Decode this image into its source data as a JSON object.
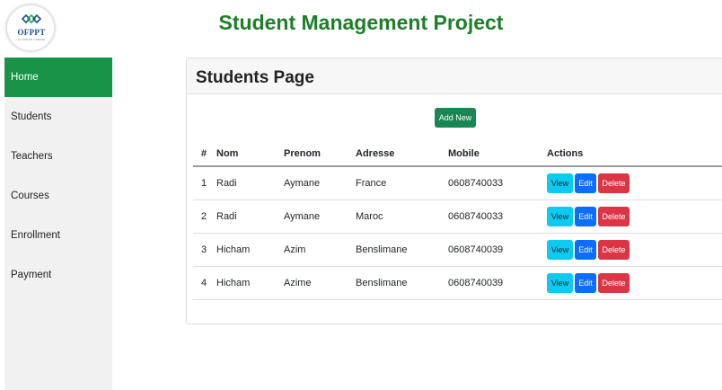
{
  "header": {
    "logo_text": "OFPPT",
    "logo_subtext": "LA VOIE DE L'AVENIR",
    "title": "Student Management Project"
  },
  "sidebar": {
    "items": [
      {
        "label": "Home",
        "active": true
      },
      {
        "label": "Students",
        "active": false
      },
      {
        "label": "Teachers",
        "active": false
      },
      {
        "label": "Courses",
        "active": false
      },
      {
        "label": "Enrollment",
        "active": false
      },
      {
        "label": "Payment",
        "active": false
      }
    ]
  },
  "page": {
    "title": "Students Page",
    "add_new_label": "Add New"
  },
  "table": {
    "columns": [
      "#",
      "Nom",
      "Prenom",
      "Adresse",
      "Mobile",
      "Actions"
    ],
    "rows": [
      {
        "id": "1",
        "nom": "Radi",
        "prenom": "Aymane",
        "adresse": "France",
        "mobile": "0608740033"
      },
      {
        "id": "2",
        "nom": "Radi",
        "prenom": "Aymane",
        "adresse": "Maroc",
        "mobile": "0608740033"
      },
      {
        "id": "3",
        "nom": "Hicham",
        "prenom": "Azim",
        "adresse": "Benslimane",
        "mobile": "0608740039"
      },
      {
        "id": "4",
        "nom": "Hicham",
        "prenom": "Azime",
        "adresse": "Benslimane",
        "mobile": "0608740039"
      }
    ],
    "actions": {
      "view": "View",
      "edit": "Edit",
      "delete": "Delete"
    }
  },
  "colors": {
    "title_green": "#1e7e2a",
    "active_nav": "#199347",
    "add_button": "#198754",
    "view_button": "#0dcaf0",
    "edit_button": "#0d6efd",
    "delete_button": "#dc3545"
  }
}
